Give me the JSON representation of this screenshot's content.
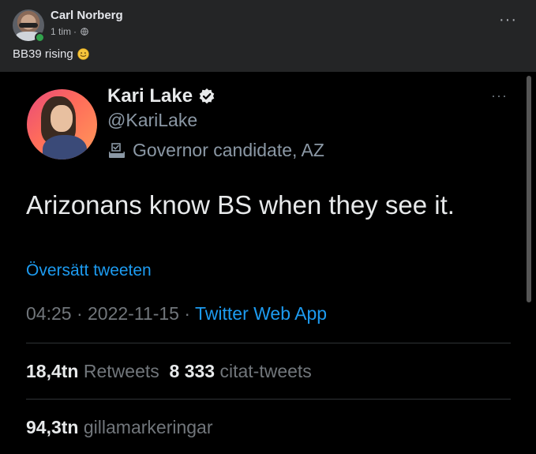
{
  "post": {
    "author": "Carl Norberg",
    "time": "1 tim",
    "separator": "·",
    "more": "···",
    "text": "BB39 rising",
    "emoji_icon": "smiling-face-emoji"
  },
  "tweet": {
    "name": "Kari Lake",
    "handle": "@KariLake",
    "role": "Governor candidate, AZ",
    "text": "Arizonans know BS when they see it.",
    "translate": "Översätt tweeten",
    "time": "04:25",
    "date": "2022-11-15",
    "sep": " · ",
    "app": "Twitter Web App",
    "retweets_count": "18,4tn",
    "retweets_label": "Retweets",
    "quotes_count": "8 333",
    "quotes_label": "citat-tweets",
    "likes_count": "94,3tn",
    "likes_label": "gillamarkeringar",
    "more": "···"
  },
  "colors": {
    "fb_bg": "#242526",
    "twitter_link": "#1d9bf0",
    "twitter_secondary": "#71767b"
  }
}
